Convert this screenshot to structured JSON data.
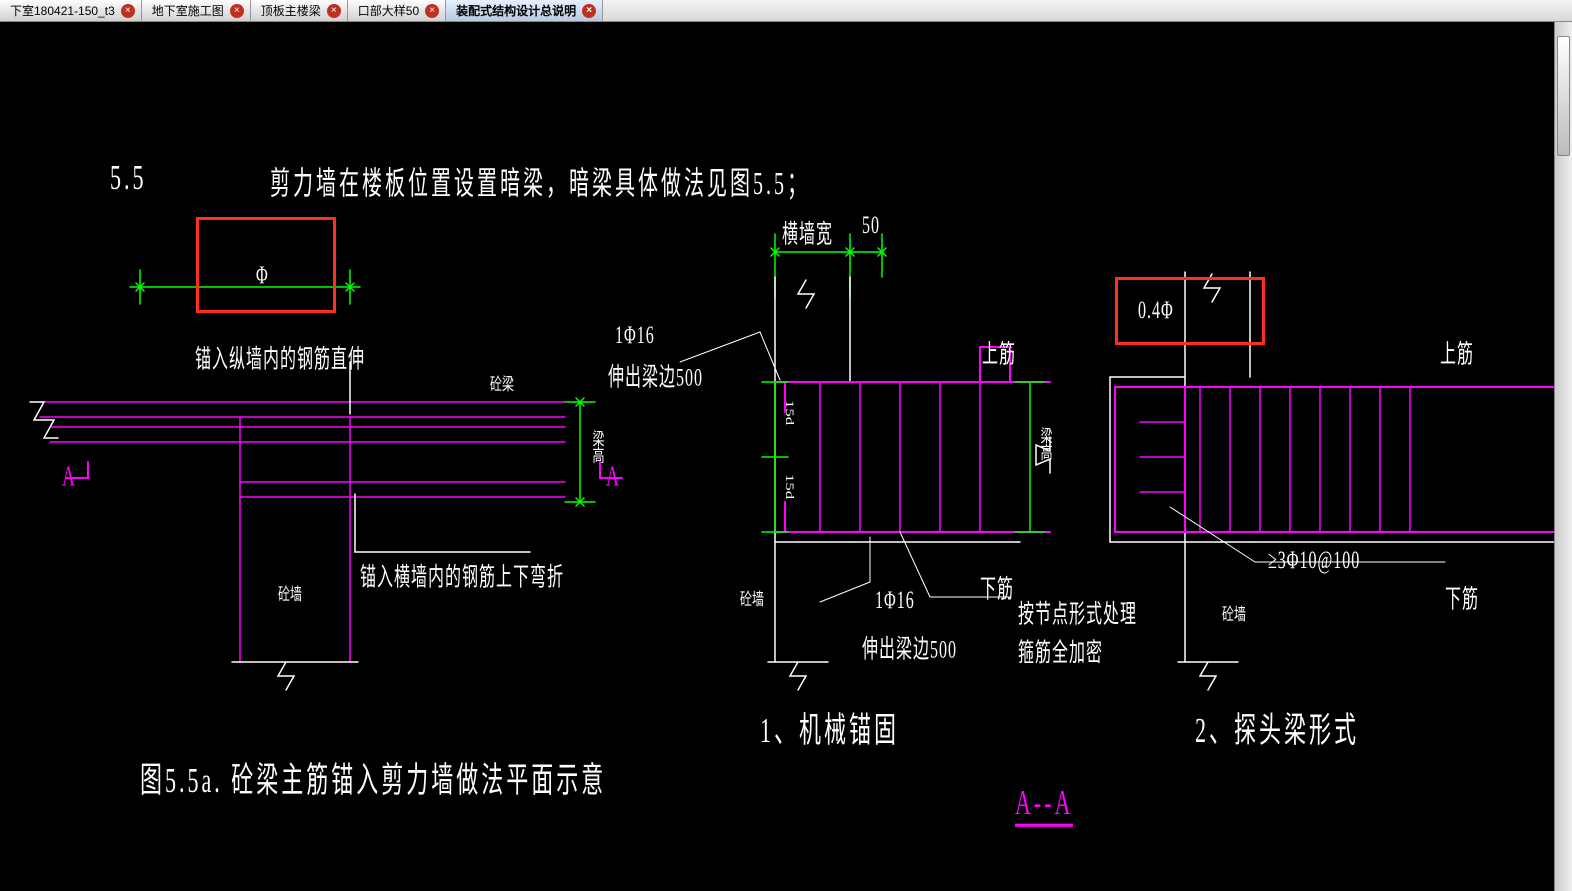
{
  "tabs": [
    {
      "label": "下室180421-150_t3",
      "active": false
    },
    {
      "label": "地下室施工图",
      "active": false
    },
    {
      "label": "顶板主楼梁",
      "active": false
    },
    {
      "label": "口部大样50",
      "active": false
    },
    {
      "label": "装配式结构设计总说明",
      "active": true
    }
  ],
  "drawing": {
    "section_no": "5.5",
    "heading": "剪力墙在楼板位置设置暗梁，暗梁具体做法见图5.5；",
    "left_box_symbol": "Φ",
    "label_top_left": "锚入纵墙内的钢筋直伸",
    "label_mid_left": "砼梁",
    "label_bottom_left": "锚入横墙内的钢筋上下弯折",
    "label_wall": "砼墙",
    "label_beam_height": "梁高",
    "section_mark_A": "A",
    "fig_caption_left": "图5.5a.  砼梁主筋锚入剪力墙做法平面示意",
    "dim_top": "横墙宽",
    "dim_top_val": "50",
    "bar_spec": "1Φ16",
    "extend_spec": "伸出梁边500",
    "dim_15d": "15d",
    "label_top_bar": "上筋",
    "label_bot_bar": "下筋",
    "label_beam_h2": "梁高",
    "note_right": "按节点形式处理\n箍筋全加密",
    "sub1": "1、机械锚固",
    "right_box_val": "0.4Φ",
    "bar_group_spec": "≥3Φ10@100",
    "sub2": "2、探头梁形式",
    "section_AA": "A--A"
  },
  "colors": {
    "green": "#00ff00",
    "magenta": "#ff00ff",
    "white": "#ffffff",
    "red": "#ff3020"
  }
}
